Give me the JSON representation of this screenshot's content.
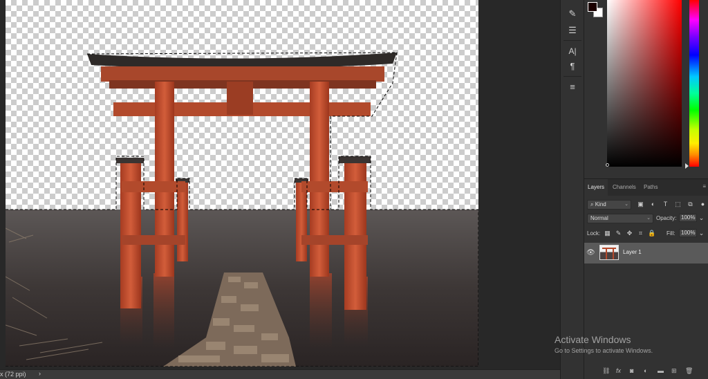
{
  "status_bar": {
    "zoom_info": "x (72 ppi)",
    "arrow": "›"
  },
  "tool_strip": {
    "tools": [
      {
        "icon": "brush-settings-icon",
        "glyph": "✎"
      },
      {
        "icon": "adjust-sliders-icon",
        "glyph": "☰"
      },
      {
        "icon": "character-icon",
        "glyph": "A|"
      },
      {
        "icon": "paragraph-icon",
        "glyph": "¶"
      },
      {
        "icon": "properties-icon",
        "glyph": "≡"
      }
    ]
  },
  "color_panel": {
    "foreground": "#1a0000",
    "background": "#ffffff"
  },
  "layers_panel": {
    "tabs": [
      "Layers",
      "Channels",
      "Paths"
    ],
    "active_tab": "Layers",
    "filter_label": "Kind",
    "blend_mode": "Normal",
    "opacity_label": "Opacity:",
    "opacity_value": "100%",
    "lock_label": "Lock:",
    "fill_label": "Fill:",
    "fill_value": "100%",
    "layers": [
      {
        "name": "Layer 1",
        "visible": true
      }
    ]
  },
  "watermark": {
    "title": "Activate Windows",
    "subtitle": "Go to Settings to activate Windows."
  }
}
